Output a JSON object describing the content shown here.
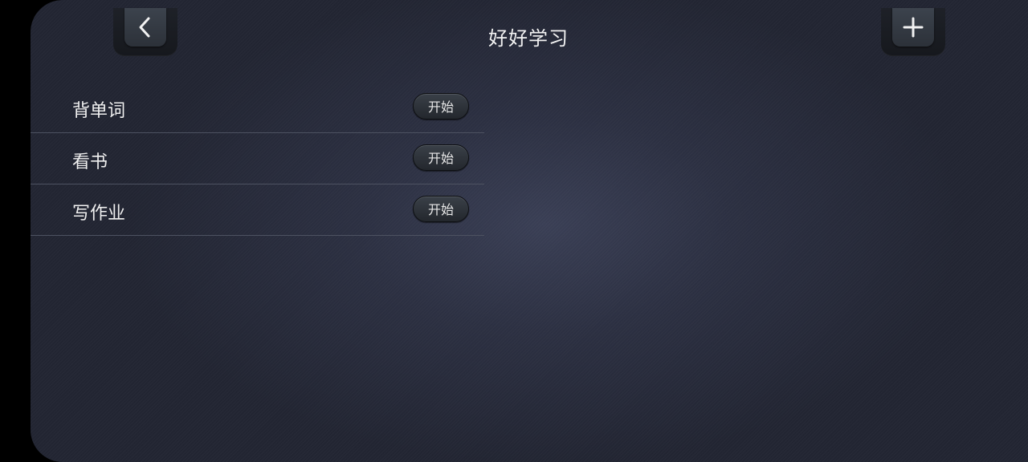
{
  "header": {
    "title": "好好学习",
    "back_icon": "chevron-left-icon",
    "add_icon": "plus-icon"
  },
  "tasks": [
    {
      "label": "背单词",
      "action": "开始"
    },
    {
      "label": "看书",
      "action": "开始"
    },
    {
      "label": "写作业",
      "action": "开始"
    }
  ],
  "colors": {
    "background": "#2c3042",
    "text": "#f0f0f0",
    "divider": "#4d5261",
    "button": "#2c3139"
  }
}
